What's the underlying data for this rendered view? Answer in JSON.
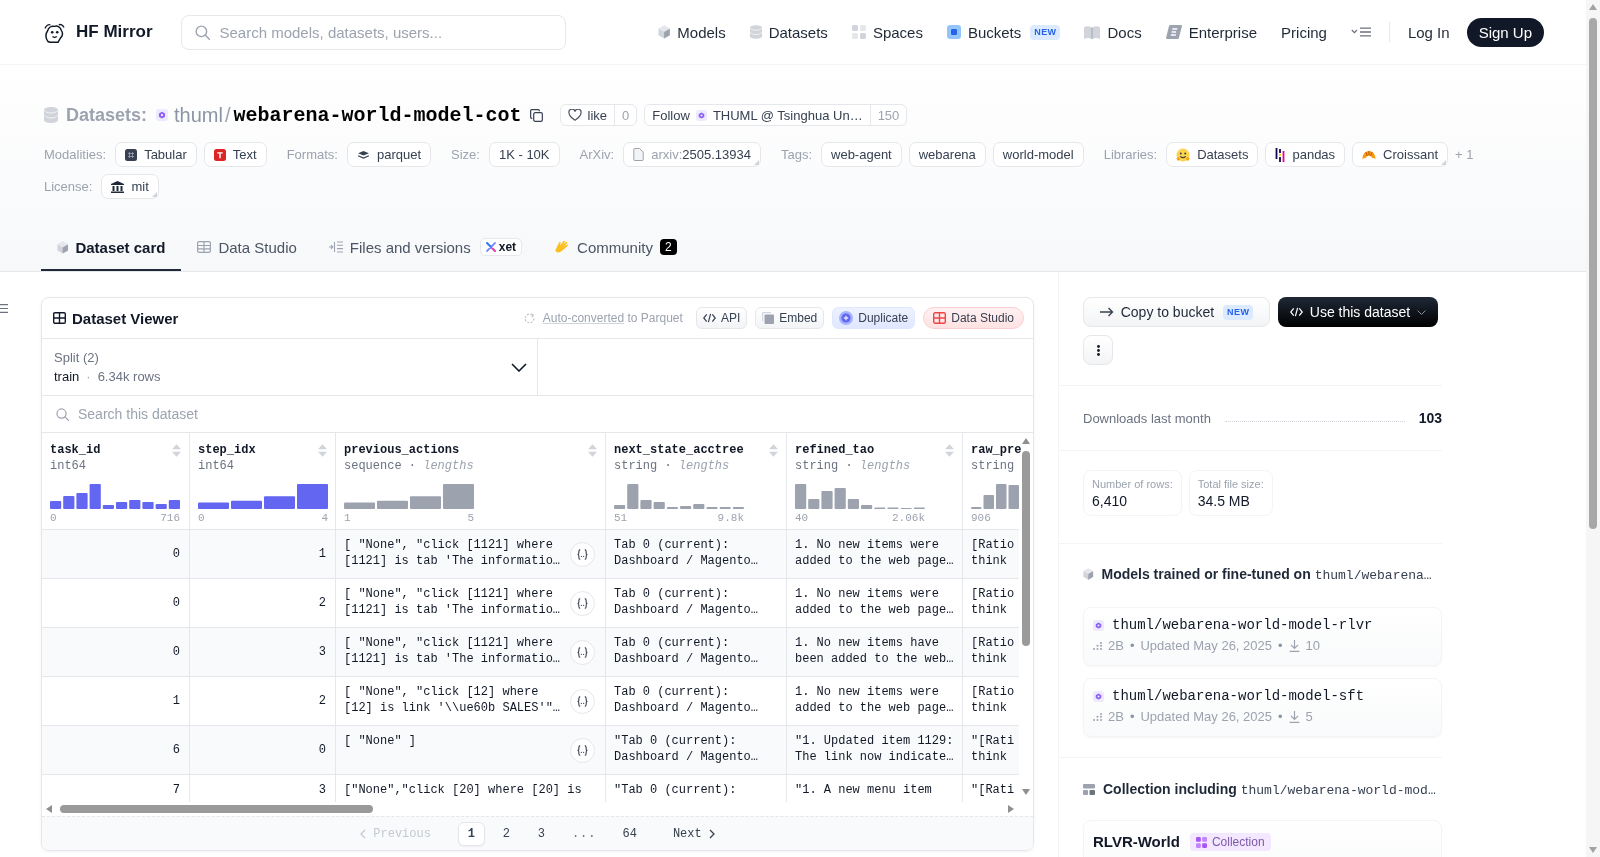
{
  "header": {
    "brand": "HF Mirror",
    "search": {
      "placeholder": "Search models, datasets, users..."
    },
    "nav": [
      {
        "label": "Models"
      },
      {
        "label": "Datasets"
      },
      {
        "label": "Spaces"
      },
      {
        "label": "Buckets",
        "badge": "NEW"
      },
      {
        "label": "Docs"
      },
      {
        "label": "Enterprise"
      },
      {
        "label": "Pricing"
      }
    ],
    "login": "Log In",
    "signup": "Sign Up"
  },
  "repo": {
    "type": "Datasets:",
    "owner": "thuml",
    "separator": "/",
    "name": "webarena-world-model-cot",
    "like": {
      "label": "like",
      "count": "0"
    },
    "follow": {
      "label": "Follow",
      "org": "THUML @ Tsinghua Un…",
      "count": "150"
    }
  },
  "metadata": [
    {
      "label": "Modalities:",
      "chips": [
        {
          "text": "Tabular",
          "menu": false
        },
        {
          "text": "Text",
          "menu": false
        }
      ]
    },
    {
      "label": "Formats:",
      "chips": [
        {
          "text": "parquet",
          "menu": false
        }
      ]
    },
    {
      "label": "Size:",
      "chips": [
        {
          "text": "1K - 10K",
          "menu": false
        }
      ]
    },
    {
      "label": "ArXiv:",
      "chips": [
        {
          "prefix": "arxiv:",
          "text": "2505.13934",
          "menu": true
        }
      ]
    },
    {
      "label": "Tags:",
      "chips": [
        {
          "text": "web-agent",
          "menu": false
        },
        {
          "text": "webarena",
          "menu": false
        },
        {
          "text": "world-model",
          "menu": false
        }
      ]
    },
    {
      "label": "Libraries:",
      "chips": [
        {
          "text": "Datasets",
          "menu": false
        },
        {
          "text": "pandas",
          "menu": false
        },
        {
          "text": "Croissant",
          "menu": true
        }
      ],
      "more": "+ 1"
    },
    {
      "label": "License:",
      "chips": [
        {
          "text": "mit",
          "menu": true
        }
      ]
    }
  ],
  "tabs": [
    {
      "label": "Dataset card",
      "selected": true
    },
    {
      "label": "Data Studio",
      "selected": false
    },
    {
      "label": "Files and versions",
      "badge": "xet",
      "selected": false
    },
    {
      "label": "Community",
      "count": "2",
      "selected": false
    }
  ],
  "viewer": {
    "title": "Dataset Viewer",
    "conversion": {
      "link": "Auto-converted",
      "text": "to Parquet"
    },
    "buttons": [
      {
        "label": "API",
        "kind": "plain"
      },
      {
        "label": "Embed",
        "kind": "plain"
      },
      {
        "label": "Duplicate",
        "kind": "indigo"
      },
      {
        "label": "Data Studio",
        "kind": "red"
      }
    ],
    "split": {
      "label": "Split (2)",
      "value": "train",
      "separator": "·",
      "rows": "6.34k rows"
    },
    "search": {
      "placeholder": "Search this dataset"
    },
    "columns": [
      {
        "name": "task_id",
        "type": "int64",
        "kind": "numeric",
        "min": "0",
        "max": "716",
        "sortable": true
      },
      {
        "name": "step_idx",
        "type": "int64",
        "kind": "numeric",
        "min": "0",
        "max": "4",
        "sortable": true
      },
      {
        "name": "previous_actions",
        "type": "sequence",
        "separator": "·",
        "stat": "lengths",
        "kind": "sequence",
        "min": "1",
        "max": "5",
        "sortable": true
      },
      {
        "name": "next_state_acctree",
        "type": "string",
        "separator": "·",
        "stat": "lengths",
        "kind": "string",
        "min": "51",
        "max": "9.8k",
        "sortable": true
      },
      {
        "name": "refined_tao",
        "type": "string",
        "separator": "·",
        "stat": "lengths",
        "kind": "string",
        "min": "40",
        "max": "2.06k",
        "sortable": true
      },
      {
        "name": "raw_pre",
        "type": "string",
        "kind": "string",
        "min": "906"
      }
    ],
    "rows": [
      {
        "cells": [
          "0",
          "1",
          "[ \"None\", \"click [1121] where [1121] is tab 'The informatio…",
          "Tab 0 (current): Dashboard / Magento…",
          "1. No new items were added to the web page…",
          "[Ratio think"
        ],
        "expandable": true
      },
      {
        "cells": [
          "0",
          "2",
          "[ \"None\", \"click [1121] where [1121] is tab 'The informatio…",
          "Tab 0 (current): Dashboard / Magento…",
          "1. No new items were added to the web page…",
          "[Ratio think"
        ],
        "expandable": true
      },
      {
        "cells": [
          "0",
          "3",
          "[ \"None\", \"click [1121] where [1121] is tab 'The informatio…",
          "Tab 0 (current): Dashboard / Magento…",
          "1. No new items have been added to the web…",
          "[Ratio think"
        ],
        "expandable": true
      },
      {
        "cells": [
          "1",
          "2",
          "[ \"None\", \"click [12] where [12] is link '\\\\ue60b SALES'\"…",
          "Tab 0 (current): Dashboard / Magento…",
          "1. No new items were added to the web page…",
          "[Ratio think"
        ],
        "expandable": true
      },
      {
        "cells": [
          "6",
          "0",
          "[ \"None\" ]",
          "\"Tab 0 (current): Dashboard / Magento…",
          "\"1. Updated item 1129: The link now indicate…",
          "\"[Rati think"
        ],
        "expandable": true
      },
      {
        "cells": [
          "7",
          "3",
          "[\"None\",\"click [20] where [20] is",
          "\"Tab 0 (current):",
          "\"1. A new menu item",
          "\"[Rati"
        ],
        "expandable": false
      }
    ],
    "pagination": {
      "previous": {
        "label": "Previous",
        "disabled": true
      },
      "pages": [
        {
          "label": "1",
          "kind": "page",
          "selected": true
        },
        {
          "label": "2",
          "kind": "page",
          "selected": false
        },
        {
          "label": "3",
          "kind": "page",
          "selected": false
        },
        {
          "label": "...",
          "kind": "gap",
          "selected": false
        },
        {
          "label": "64",
          "kind": "page",
          "selected": false
        }
      ],
      "next": {
        "label": "Next",
        "disabled": false
      }
    }
  },
  "sidebar": {
    "copy_button": {
      "label": "Copy to bucket",
      "badge": "NEW"
    },
    "use_button": {
      "label": "Use this dataset"
    },
    "downloads": {
      "label": "Downloads last month",
      "value": "103"
    },
    "stats": [
      {
        "label": "Number of rows:",
        "value": "6,410"
      },
      {
        "label": "Total file size:",
        "value": "34.5 MB"
      }
    ],
    "models": {
      "heading": "Models trained or fine-tuned on",
      "repo": "thuml/webarena…",
      "separator": "•",
      "items": [
        {
          "name": "thuml/webarena-world-model-rlvr",
          "size": "2B",
          "updated": "Updated May 26, 2025",
          "downloads": "10"
        },
        {
          "name": "thuml/webarena-world-model-sft",
          "size": "2B",
          "updated": "Updated May 26, 2025",
          "downloads": "5"
        }
      ]
    },
    "collections": {
      "heading": "Collection including",
      "repo": "thuml/webarena-world-mod…",
      "items": [
        {
          "name": "RLVR-World",
          "badge": "Collection"
        }
      ]
    }
  }
}
